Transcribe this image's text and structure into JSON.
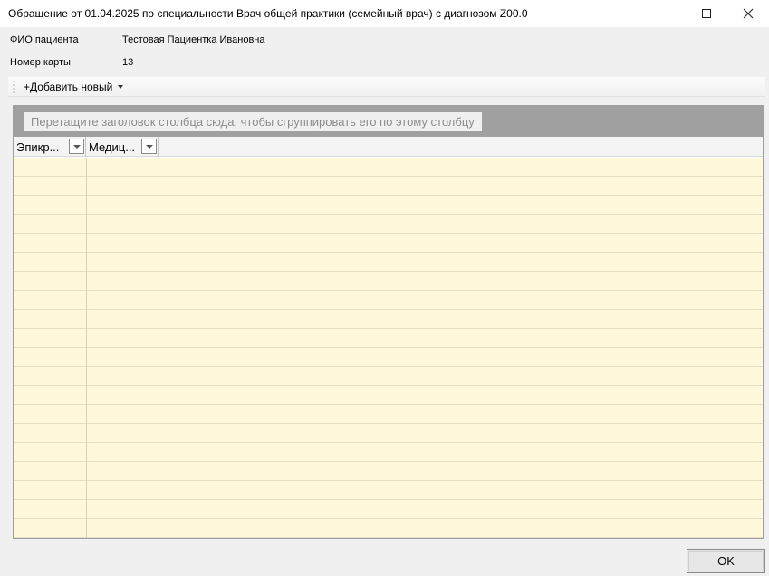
{
  "window": {
    "title": "Обращение от 01.04.2025  по специальности Врач общей практики (семейный врач) с диагнозом Z00.0",
    "controls": [
      "minimize-icon",
      "maximize-icon",
      "close-icon"
    ]
  },
  "patient": {
    "name_label": "ФИО пациента",
    "name_value": "Тестовая Пациентка Ивановна",
    "card_label": "Номер карты",
    "card_value": "13"
  },
  "toolbar": {
    "add_label": "+Добавить новый"
  },
  "grid": {
    "group_hint": "Перетащите заголовок столбца сюда, чтобы сгруппировать его по этому столбцу",
    "columns": [
      {
        "label": "Эпикр..."
      },
      {
        "label": "Медиц..."
      }
    ],
    "row_count": 20
  },
  "footer": {
    "ok_label": "OK"
  },
  "colors": {
    "row_background": "#fff8db",
    "group_panel": "#a0a0a0"
  }
}
